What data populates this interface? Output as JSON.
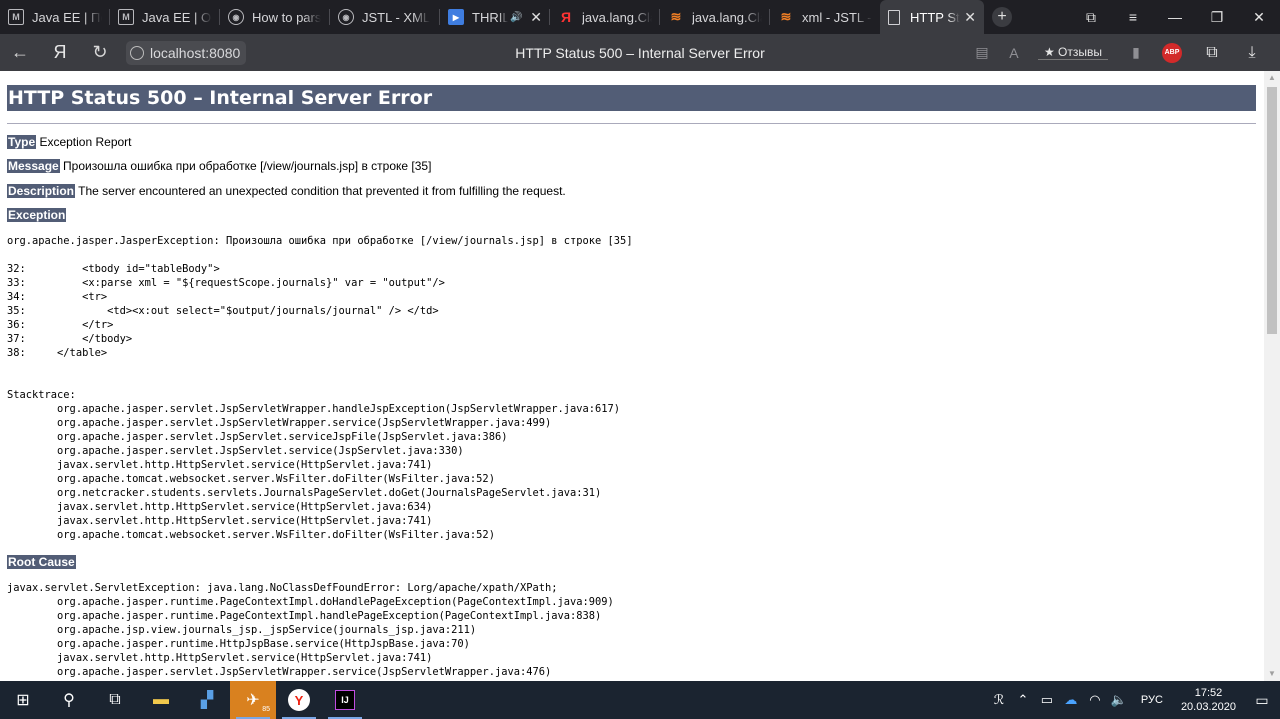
{
  "browser": {
    "tabs": [
      {
        "title": "Java EE | Пер",
        "favicon": "gmail-icon",
        "fav": "M"
      },
      {
        "title": "Java EE | Ос",
        "favicon": "gmail-icon",
        "fav": "M"
      },
      {
        "title": "How to pars",
        "favicon": "page-icon",
        "fav": "◉"
      },
      {
        "title": "JSTL - XML",
        "favicon": "page-icon",
        "fav": "◉"
      },
      {
        "title": "THRILI",
        "favicon": "play-icon",
        "fav": "▶",
        "sound": "🔊",
        "closeable": true
      },
      {
        "title": "java.lang.Cla",
        "favicon": "yandex-icon",
        "fav": "Я"
      },
      {
        "title": "java.lang.Cla",
        "favicon": "stackoverflow-icon",
        "fav": "≋"
      },
      {
        "title": "xml - JSTL -",
        "favicon": "stackoverflow-icon",
        "fav": "≋"
      },
      {
        "title": "HTTP Stat",
        "favicon": "document-icon",
        "fav": "",
        "active": true
      }
    ],
    "new_tab": "+",
    "window_controls": {
      "collections": "⧉",
      "menu": "≡",
      "minimize": "—",
      "restore": "❐",
      "close": "✕"
    },
    "nav": {
      "back": "←",
      "yandex": "Я",
      "reload": "↻"
    },
    "url_host": "localhost:8080",
    "page_title": "HTTP Status 500 – Internal Server Error",
    "right": {
      "reader": "▤",
      "translate": "A",
      "reviews": "★ Отзывы",
      "bookmark": "▮",
      "abp": "ABP",
      "collections": "⧉",
      "download": "⤓"
    }
  },
  "page": {
    "title": "HTTP Status 500 – Internal Server Error",
    "type_label": "Type",
    "type_value": " Exception Report",
    "message_label": "Message",
    "message_value": " Произошла ошибка при обработке [/view/journals.jsp] в строке [35]",
    "description_label": "Description",
    "description_value": " The server encountered an unexpected condition that prevented it from fulfilling the request.",
    "exception_label": "Exception",
    "exception_text": "org.apache.jasper.JasperException: Произошла ошибка при обработке [/view/journals.jsp] в строке [35]\n\n32:         <tbody id=\"tableBody\">\n33:         <x:parse xml = \"${requestScope.journals}\" var = \"output\"/>\n34:         <tr>\n35:             <td><x:out select=\"$output/journals/journal\" /> </td>\n36:         </tr>\n37:         </tbody>\n38:     </table>\n\n\nStacktrace:\n\torg.apache.jasper.servlet.JspServletWrapper.handleJspException(JspServletWrapper.java:617)\n\torg.apache.jasper.servlet.JspServletWrapper.service(JspServletWrapper.java:499)\n\torg.apache.jasper.servlet.JspServlet.serviceJspFile(JspServlet.java:386)\n\torg.apache.jasper.servlet.JspServlet.service(JspServlet.java:330)\n\tjavax.servlet.http.HttpServlet.service(HttpServlet.java:741)\n\torg.apache.tomcat.websocket.server.WsFilter.doFilter(WsFilter.java:52)\n\torg.netcracker.students.servlets.JournalsPageServlet.doGet(JournalsPageServlet.java:31)\n\tjavax.servlet.http.HttpServlet.service(HttpServlet.java:634)\n\tjavax.servlet.http.HttpServlet.service(HttpServlet.java:741)\n\torg.apache.tomcat.websocket.server.WsFilter.doFilter(WsFilter.java:52)",
    "root_cause_label": "Root Cause",
    "root_cause_text": "javax.servlet.ServletException: java.lang.NoClassDefFoundError: Lorg/apache/xpath/XPath;\n\torg.apache.jasper.runtime.PageContextImpl.doHandlePageException(PageContextImpl.java:909)\n\torg.apache.jasper.runtime.PageContextImpl.handlePageException(PageContextImpl.java:838)\n\torg.apache.jsp.view.journals_jsp._jspService(journals_jsp.java:211)\n\torg.apache.jasper.runtime.HttpJspBase.service(HttpJspBase.java:70)\n\tjavax.servlet.http.HttpServlet.service(HttpServlet.java:741)\n\torg.apache.jasper.servlet.JspServletWrapper.service(JspServletWrapper.java:476)"
  },
  "taskbar": {
    "start": "⊞",
    "search": "⚲",
    "taskview": "⧉",
    "apps": [
      {
        "name": "file-explorer-icon",
        "glyph": "▬"
      },
      {
        "name": "terminal-icon",
        "glyph": "▞"
      },
      {
        "name": "telegram-icon",
        "glyph": "✈",
        "badge": "85"
      },
      {
        "name": "yandex-browser-icon",
        "glyph": "Y"
      },
      {
        "name": "intellij-icon",
        "glyph": "IJ"
      }
    ],
    "tray": {
      "people": "ℛ",
      "chevron": "⌃",
      "battery": "▭",
      "cloud": "☁",
      "network": "◠",
      "volume": "🔈"
    },
    "language": "РУС",
    "time": "17:52",
    "date": "20.03.2020",
    "notifications": "▭"
  },
  "colors": {
    "header_bg": "#525d76",
    "tabbar_bg": "#1f1f24",
    "addrbar_bg": "#3b3c41",
    "taskbar_bg": "#1b2430"
  }
}
